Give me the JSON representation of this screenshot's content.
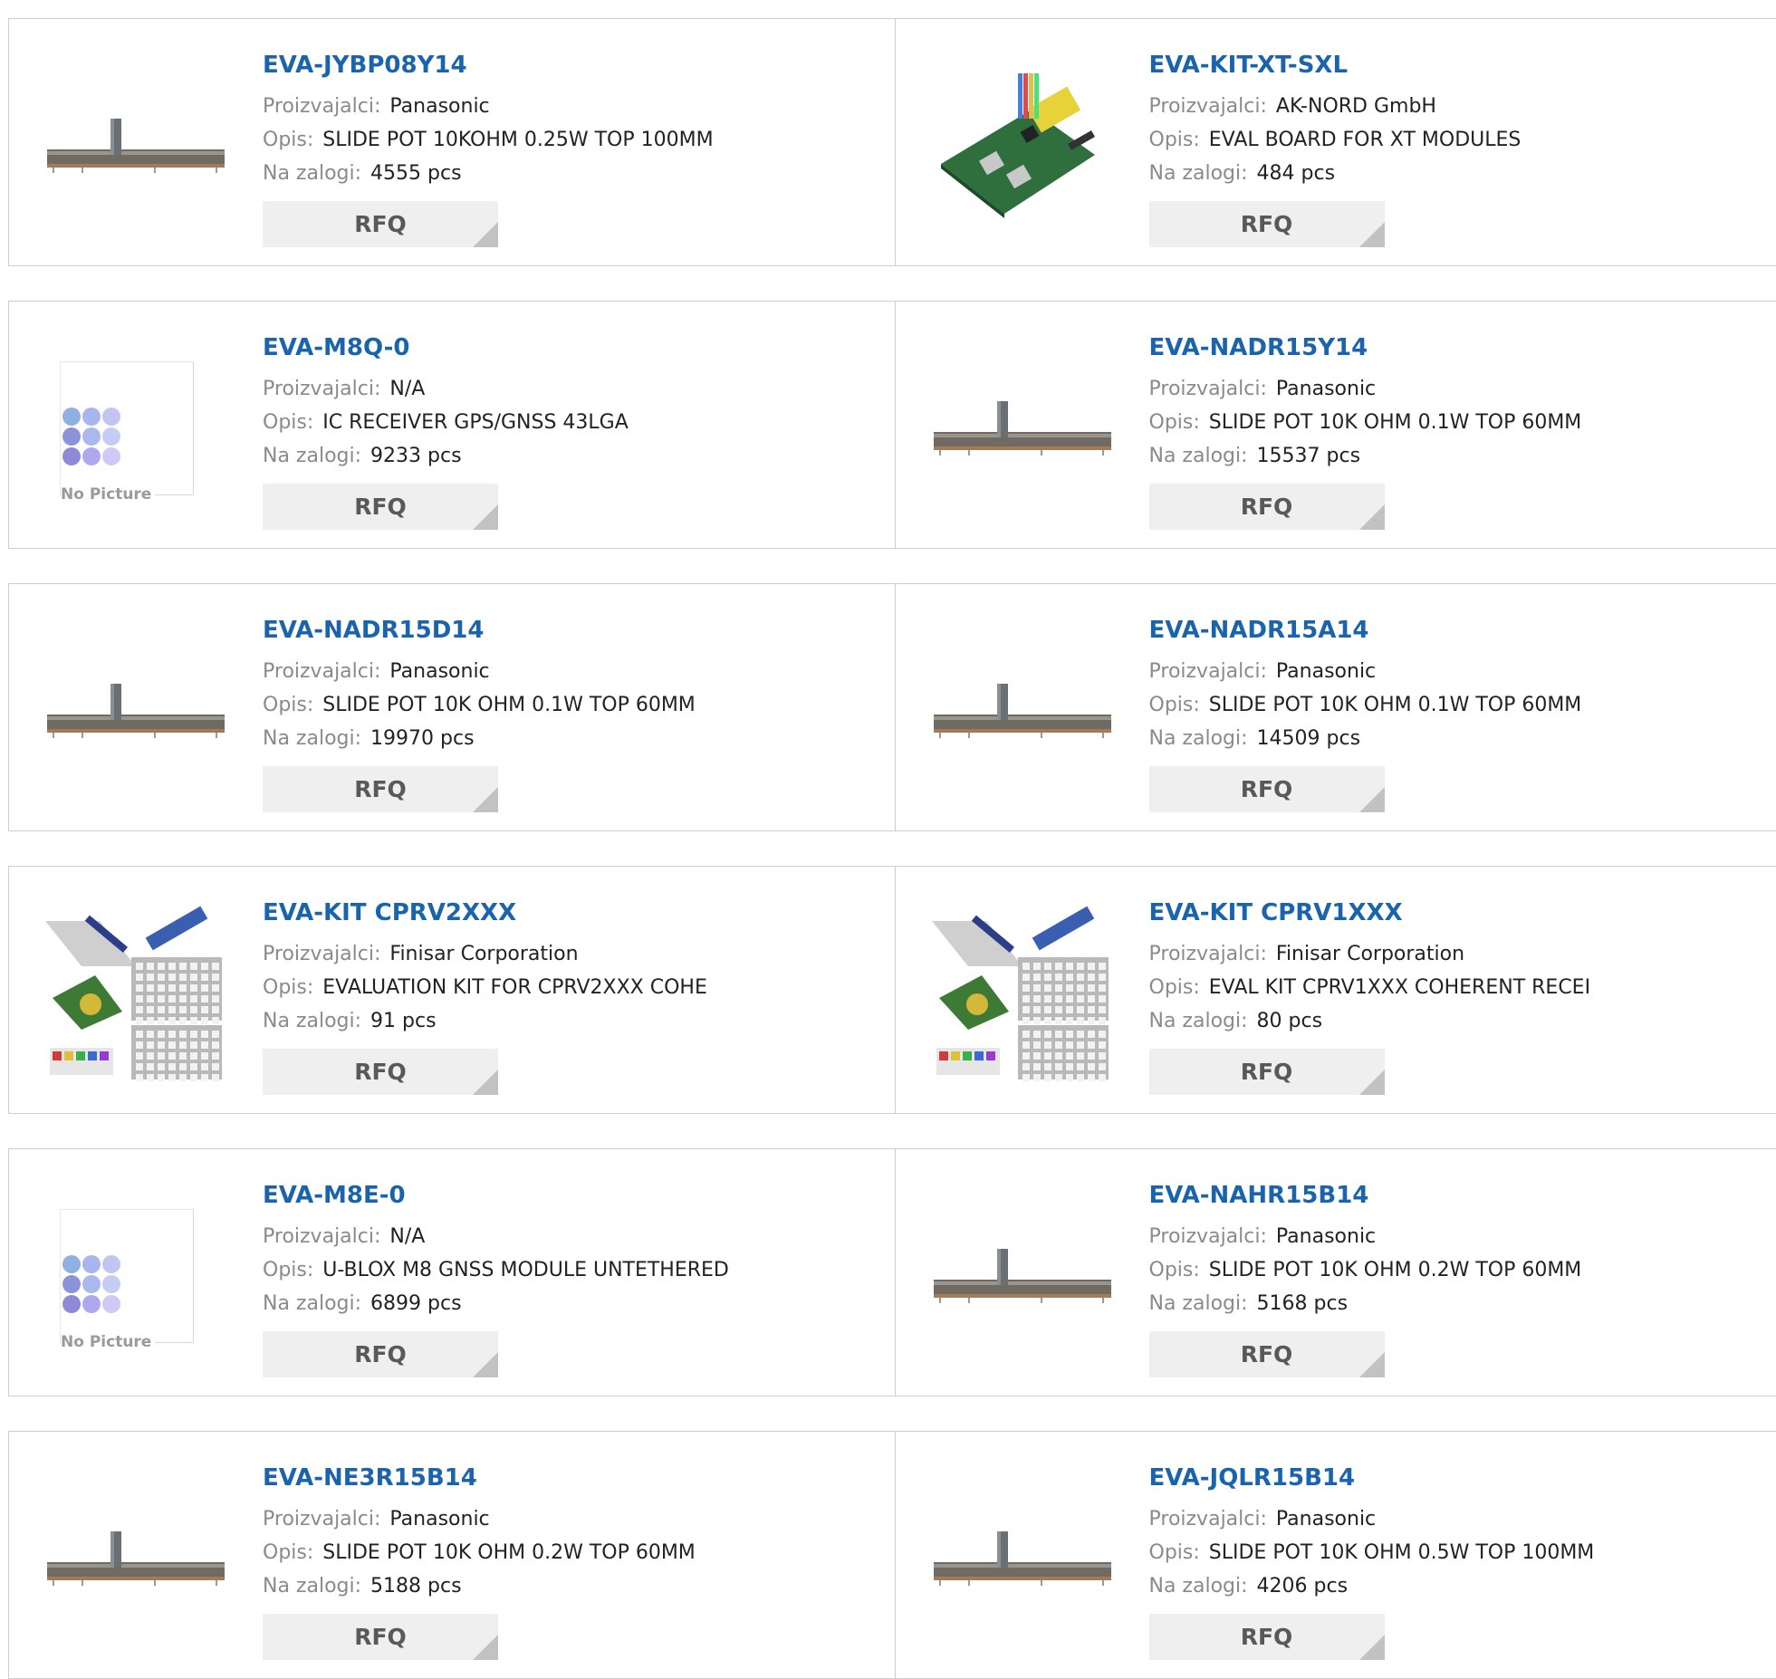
{
  "labels": {
    "manufacturer": "Proizvajalci:",
    "description": "Opis:",
    "stock": "Na zalogi:",
    "rfq": "RFQ",
    "no_picture": "No Picture"
  },
  "products": [
    {
      "name": "EVA-JYBP08Y14",
      "manufacturer": "Panasonic",
      "description": "SLIDE POT 10KOHM 0.25W TOP 100MM",
      "stock": "4555 pcs",
      "image": "slide-pot"
    },
    {
      "name": "EVA-KIT-XT-SXL",
      "manufacturer": "AK-NORD GmbH",
      "description": "EVAL BOARD FOR XT MODULES",
      "stock": "484 pcs",
      "image": "eval-board"
    },
    {
      "name": "EVA-M8Q-0",
      "manufacturer": "N/A",
      "description": "IC RECEIVER GPS/GNSS 43LGA",
      "stock": "9233 pcs",
      "image": "no-picture"
    },
    {
      "name": "EVA-NADR15Y14",
      "manufacturer": "Panasonic",
      "description": "SLIDE POT 10K OHM 0.1W TOP 60MM",
      "stock": "15537 pcs",
      "image": "slide-pot"
    },
    {
      "name": "EVA-NADR15D14",
      "manufacturer": "Panasonic",
      "description": "SLIDE POT 10K OHM 0.1W TOP 60MM",
      "stock": "19970 pcs",
      "image": "slide-pot"
    },
    {
      "name": "EVA-NADR15A14",
      "manufacturer": "Panasonic",
      "description": "SLIDE POT 10K OHM 0.1W TOP 60MM",
      "stock": "14509 pcs",
      "image": "slide-pot"
    },
    {
      "name": "EVA-KIT CPRV2XXX",
      "manufacturer": "Finisar Corporation",
      "description": "EVALUATION KIT FOR CPRV2XXX COHE",
      "stock": "91 pcs",
      "image": "eval-kit"
    },
    {
      "name": "EVA-KIT CPRV1XXX",
      "manufacturer": "Finisar Corporation",
      "description": "EVAL KIT CPRV1XXX COHERENT RECEI",
      "stock": "80 pcs",
      "image": "eval-kit"
    },
    {
      "name": "EVA-M8E-0",
      "manufacturer": "N/A",
      "description": "U-BLOX M8 GNSS MODULE UNTETHERED",
      "stock": "6899 pcs",
      "image": "no-picture"
    },
    {
      "name": "EVA-NAHR15B14",
      "manufacturer": "Panasonic",
      "description": "SLIDE POT 10K OHM 0.2W TOP 60MM",
      "stock": "5168 pcs",
      "image": "slide-pot"
    },
    {
      "name": "EVA-NE3R15B14",
      "manufacturer": "Panasonic",
      "description": "SLIDE POT 10K OHM 0.2W TOP 60MM",
      "stock": "5188 pcs",
      "image": "slide-pot"
    },
    {
      "name": "EVA-JQLR15B14",
      "manufacturer": "Panasonic",
      "description": "SLIDE POT 10K OHM 0.5W TOP 100MM",
      "stock": "4206 pcs",
      "image": "slide-pot"
    }
  ]
}
